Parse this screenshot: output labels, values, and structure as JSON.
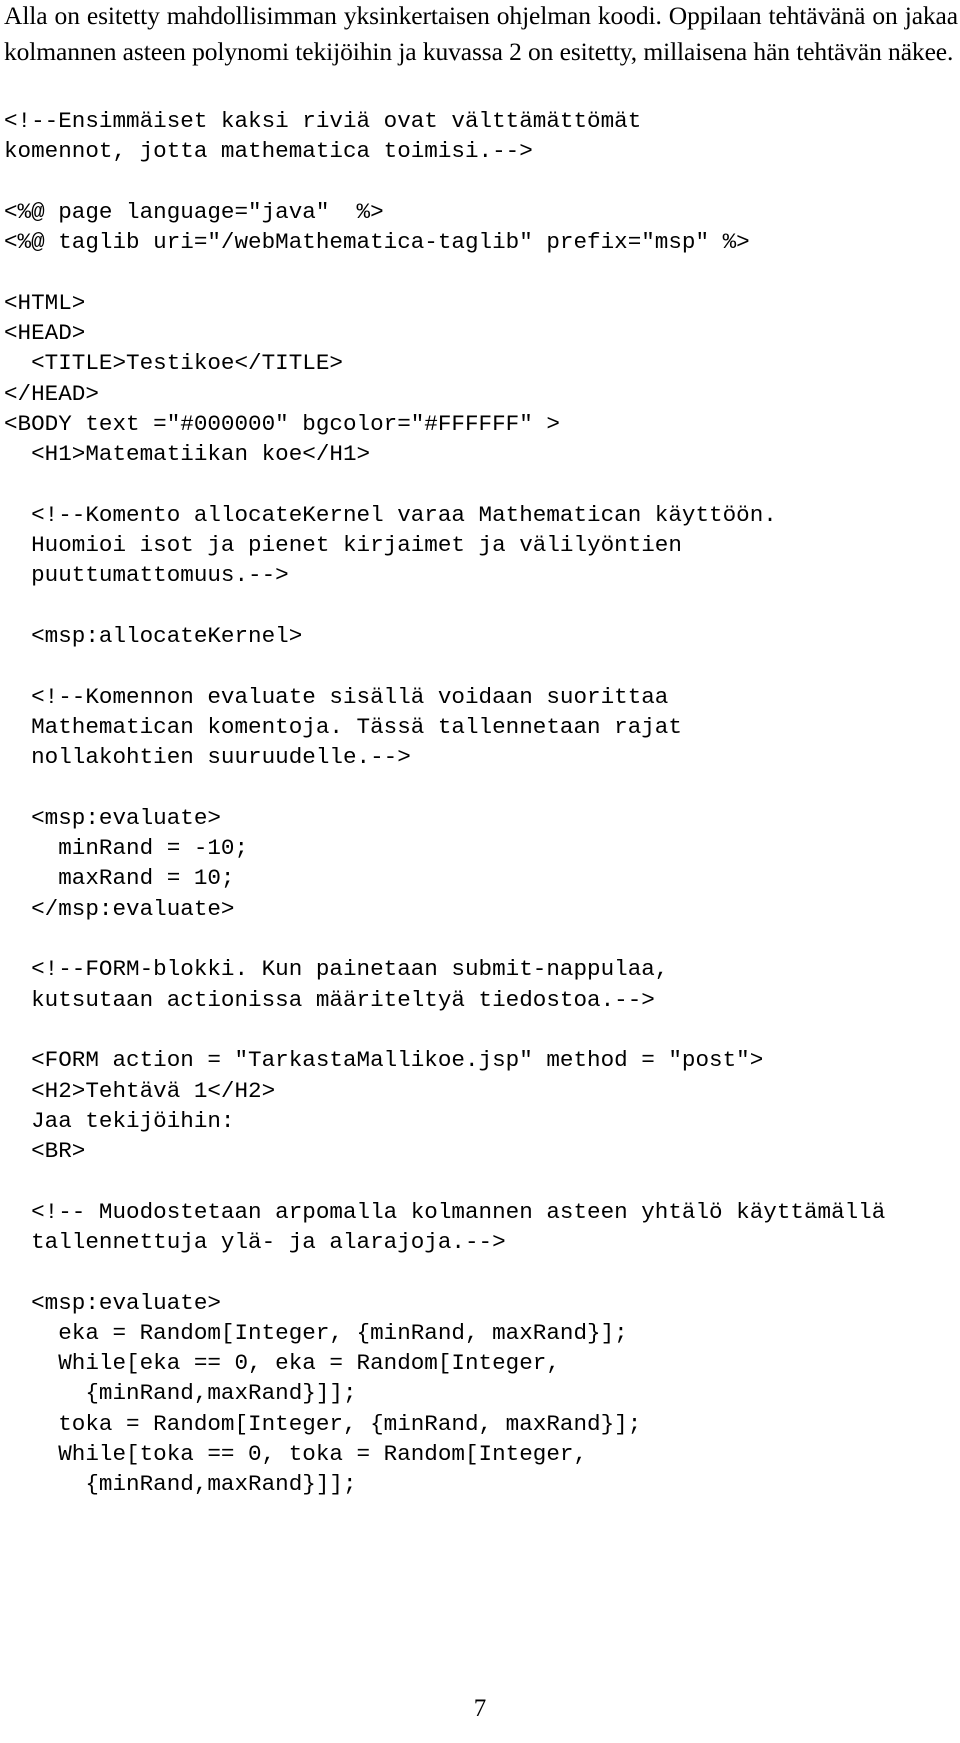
{
  "document": {
    "page_number": "7",
    "intro_paragraph": "Alla on esitetty mahdollisimman yksinkertaisen ohjelman koodi. Oppilaan tehtävänä on jakaa kolmannen asteen polynomi tekijöihin ja kuvassa 2 on esitetty, millaisena hän tehtävän näkee.",
    "code_listing": {
      "language": "jsp",
      "lines": [
        "<!--Ensimmäiset kaksi riviä ovat välttämättömät",
        "komennot, jotta mathematica toimisi.-->",
        "",
        "<%@ page language=\"java\"  %>",
        "<%@ taglib uri=\"/webMathematica-taglib\" prefix=\"msp\" %>",
        "",
        "<HTML>",
        "<HEAD>",
        "  <TITLE>Testikoe</TITLE>",
        "</HEAD>",
        "<BODY text =\"#000000\" bgcolor=\"#FFFFFF\" >",
        "  <H1>Matematiikan koe</H1>",
        "",
        "  <!--Komento allocateKernel varaa Mathematican käyttöön.",
        "  Huomioi isot ja pienet kirjaimet ja välilyöntien",
        "  puuttumattomuus.-->",
        "",
        "  <msp:allocateKernel>",
        "",
        "  <!--Komennon evaluate sisällä voidaan suorittaa",
        "  Mathematican komentoja. Tässä tallennetaan rajat",
        "  nollakohtien suuruudelle.-->",
        "",
        "  <msp:evaluate>",
        "    minRand = -10;",
        "    maxRand = 10;",
        "  </msp:evaluate>",
        "",
        "  <!--FORM-blokki. Kun painetaan submit-nappulaa,",
        "  kutsutaan actionissa määriteltyä tiedostoa.-->",
        "",
        "  <FORM action = \"TarkastaMallikoe.jsp\" method = \"post\">",
        "  <H2>Tehtävä 1</H2>",
        "  Jaa tekijöihin:",
        "  <BR>",
        "",
        "  <!-- Muodostetaan arpomalla kolmannen asteen yhtälö käyttämällä",
        "  tallennettuja ylä- ja alarajoja.-->",
        "",
        "  <msp:evaluate>",
        "    eka = Random[Integer, {minRand, maxRand}];",
        "    While[eka == 0, eka = Random[Integer,",
        "      {minRand,maxRand}]];",
        "    toka = Random[Integer, {minRand, maxRand}];",
        "    While[toka == 0, toka = Random[Integer,",
        "      {minRand,maxRand}]];"
      ]
    }
  }
}
